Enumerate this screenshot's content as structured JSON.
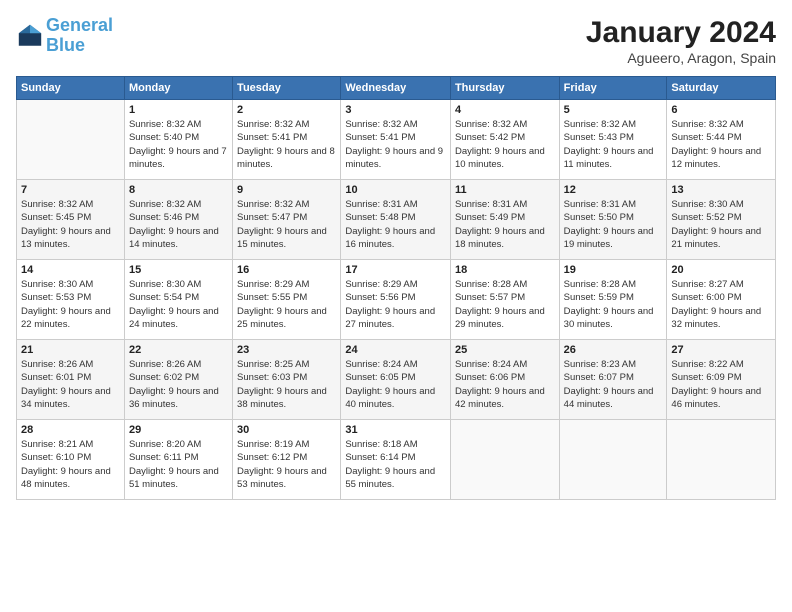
{
  "logo": {
    "line1": "General",
    "line2": "Blue"
  },
  "header": {
    "month": "January 2024",
    "location": "Agueero, Aragon, Spain"
  },
  "weekdays": [
    "Sunday",
    "Monday",
    "Tuesday",
    "Wednesday",
    "Thursday",
    "Friday",
    "Saturday"
  ],
  "weeks": [
    [
      {
        "day": "",
        "sunrise": "",
        "sunset": "",
        "daylight": ""
      },
      {
        "day": "1",
        "sunrise": "Sunrise: 8:32 AM",
        "sunset": "Sunset: 5:40 PM",
        "daylight": "Daylight: 9 hours and 7 minutes."
      },
      {
        "day": "2",
        "sunrise": "Sunrise: 8:32 AM",
        "sunset": "Sunset: 5:41 PM",
        "daylight": "Daylight: 9 hours and 8 minutes."
      },
      {
        "day": "3",
        "sunrise": "Sunrise: 8:32 AM",
        "sunset": "Sunset: 5:41 PM",
        "daylight": "Daylight: 9 hours and 9 minutes."
      },
      {
        "day": "4",
        "sunrise": "Sunrise: 8:32 AM",
        "sunset": "Sunset: 5:42 PM",
        "daylight": "Daylight: 9 hours and 10 minutes."
      },
      {
        "day": "5",
        "sunrise": "Sunrise: 8:32 AM",
        "sunset": "Sunset: 5:43 PM",
        "daylight": "Daylight: 9 hours and 11 minutes."
      },
      {
        "day": "6",
        "sunrise": "Sunrise: 8:32 AM",
        "sunset": "Sunset: 5:44 PM",
        "daylight": "Daylight: 9 hours and 12 minutes."
      }
    ],
    [
      {
        "day": "7",
        "sunrise": "Sunrise: 8:32 AM",
        "sunset": "Sunset: 5:45 PM",
        "daylight": "Daylight: 9 hours and 13 minutes."
      },
      {
        "day": "8",
        "sunrise": "Sunrise: 8:32 AM",
        "sunset": "Sunset: 5:46 PM",
        "daylight": "Daylight: 9 hours and 14 minutes."
      },
      {
        "day": "9",
        "sunrise": "Sunrise: 8:32 AM",
        "sunset": "Sunset: 5:47 PM",
        "daylight": "Daylight: 9 hours and 15 minutes."
      },
      {
        "day": "10",
        "sunrise": "Sunrise: 8:31 AM",
        "sunset": "Sunset: 5:48 PM",
        "daylight": "Daylight: 9 hours and 16 minutes."
      },
      {
        "day": "11",
        "sunrise": "Sunrise: 8:31 AM",
        "sunset": "Sunset: 5:49 PM",
        "daylight": "Daylight: 9 hours and 18 minutes."
      },
      {
        "day": "12",
        "sunrise": "Sunrise: 8:31 AM",
        "sunset": "Sunset: 5:50 PM",
        "daylight": "Daylight: 9 hours and 19 minutes."
      },
      {
        "day": "13",
        "sunrise": "Sunrise: 8:30 AM",
        "sunset": "Sunset: 5:52 PM",
        "daylight": "Daylight: 9 hours and 21 minutes."
      }
    ],
    [
      {
        "day": "14",
        "sunrise": "Sunrise: 8:30 AM",
        "sunset": "Sunset: 5:53 PM",
        "daylight": "Daylight: 9 hours and 22 minutes."
      },
      {
        "day": "15",
        "sunrise": "Sunrise: 8:30 AM",
        "sunset": "Sunset: 5:54 PM",
        "daylight": "Daylight: 9 hours and 24 minutes."
      },
      {
        "day": "16",
        "sunrise": "Sunrise: 8:29 AM",
        "sunset": "Sunset: 5:55 PM",
        "daylight": "Daylight: 9 hours and 25 minutes."
      },
      {
        "day": "17",
        "sunrise": "Sunrise: 8:29 AM",
        "sunset": "Sunset: 5:56 PM",
        "daylight": "Daylight: 9 hours and 27 minutes."
      },
      {
        "day": "18",
        "sunrise": "Sunrise: 8:28 AM",
        "sunset": "Sunset: 5:57 PM",
        "daylight": "Daylight: 9 hours and 29 minutes."
      },
      {
        "day": "19",
        "sunrise": "Sunrise: 8:28 AM",
        "sunset": "Sunset: 5:59 PM",
        "daylight": "Daylight: 9 hours and 30 minutes."
      },
      {
        "day": "20",
        "sunrise": "Sunrise: 8:27 AM",
        "sunset": "Sunset: 6:00 PM",
        "daylight": "Daylight: 9 hours and 32 minutes."
      }
    ],
    [
      {
        "day": "21",
        "sunrise": "Sunrise: 8:26 AM",
        "sunset": "Sunset: 6:01 PM",
        "daylight": "Daylight: 9 hours and 34 minutes."
      },
      {
        "day": "22",
        "sunrise": "Sunrise: 8:26 AM",
        "sunset": "Sunset: 6:02 PM",
        "daylight": "Daylight: 9 hours and 36 minutes."
      },
      {
        "day": "23",
        "sunrise": "Sunrise: 8:25 AM",
        "sunset": "Sunset: 6:03 PM",
        "daylight": "Daylight: 9 hours and 38 minutes."
      },
      {
        "day": "24",
        "sunrise": "Sunrise: 8:24 AM",
        "sunset": "Sunset: 6:05 PM",
        "daylight": "Daylight: 9 hours and 40 minutes."
      },
      {
        "day": "25",
        "sunrise": "Sunrise: 8:24 AM",
        "sunset": "Sunset: 6:06 PM",
        "daylight": "Daylight: 9 hours and 42 minutes."
      },
      {
        "day": "26",
        "sunrise": "Sunrise: 8:23 AM",
        "sunset": "Sunset: 6:07 PM",
        "daylight": "Daylight: 9 hours and 44 minutes."
      },
      {
        "day": "27",
        "sunrise": "Sunrise: 8:22 AM",
        "sunset": "Sunset: 6:09 PM",
        "daylight": "Daylight: 9 hours and 46 minutes."
      }
    ],
    [
      {
        "day": "28",
        "sunrise": "Sunrise: 8:21 AM",
        "sunset": "Sunset: 6:10 PM",
        "daylight": "Daylight: 9 hours and 48 minutes."
      },
      {
        "day": "29",
        "sunrise": "Sunrise: 8:20 AM",
        "sunset": "Sunset: 6:11 PM",
        "daylight": "Daylight: 9 hours and 51 minutes."
      },
      {
        "day": "30",
        "sunrise": "Sunrise: 8:19 AM",
        "sunset": "Sunset: 6:12 PM",
        "daylight": "Daylight: 9 hours and 53 minutes."
      },
      {
        "day": "31",
        "sunrise": "Sunrise: 8:18 AM",
        "sunset": "Sunset: 6:14 PM",
        "daylight": "Daylight: 9 hours and 55 minutes."
      },
      {
        "day": "",
        "sunrise": "",
        "sunset": "",
        "daylight": ""
      },
      {
        "day": "",
        "sunrise": "",
        "sunset": "",
        "daylight": ""
      },
      {
        "day": "",
        "sunrise": "",
        "sunset": "",
        "daylight": ""
      }
    ]
  ]
}
